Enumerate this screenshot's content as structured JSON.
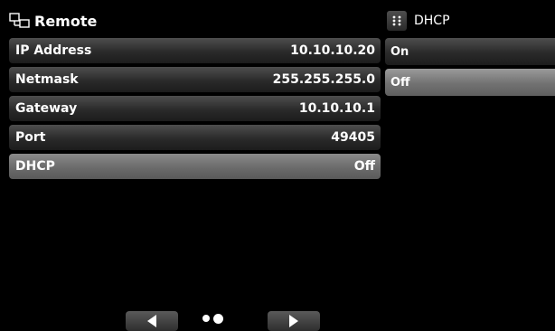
{
  "header": {
    "title": "Remote",
    "icon": "network-icon"
  },
  "settings": [
    {
      "label": "IP Address",
      "value": "10.10.10.20",
      "selected": false
    },
    {
      "label": "Netmask",
      "value": "255.255.255.0",
      "selected": false
    },
    {
      "label": "Gateway",
      "value": "10.10.10.1",
      "selected": false
    },
    {
      "label": "Port",
      "value": "49405",
      "selected": false
    },
    {
      "label": "DHCP",
      "value": "Off",
      "selected": true
    }
  ],
  "dhcp_panel": {
    "title": "DHCP",
    "icon": "grid-menu-icon",
    "options": [
      {
        "label": "On",
        "selected": false
      },
      {
        "label": "Off",
        "selected": true
      }
    ]
  },
  "nav": {
    "prev_icon": "left-arrow-icon",
    "next_icon": "right-arrow-icon",
    "page_count": 2,
    "current_page": 2
  },
  "colors": {
    "background": "#000000",
    "row": "#2a2a2a",
    "selected_row": "#6b6b6b"
  }
}
